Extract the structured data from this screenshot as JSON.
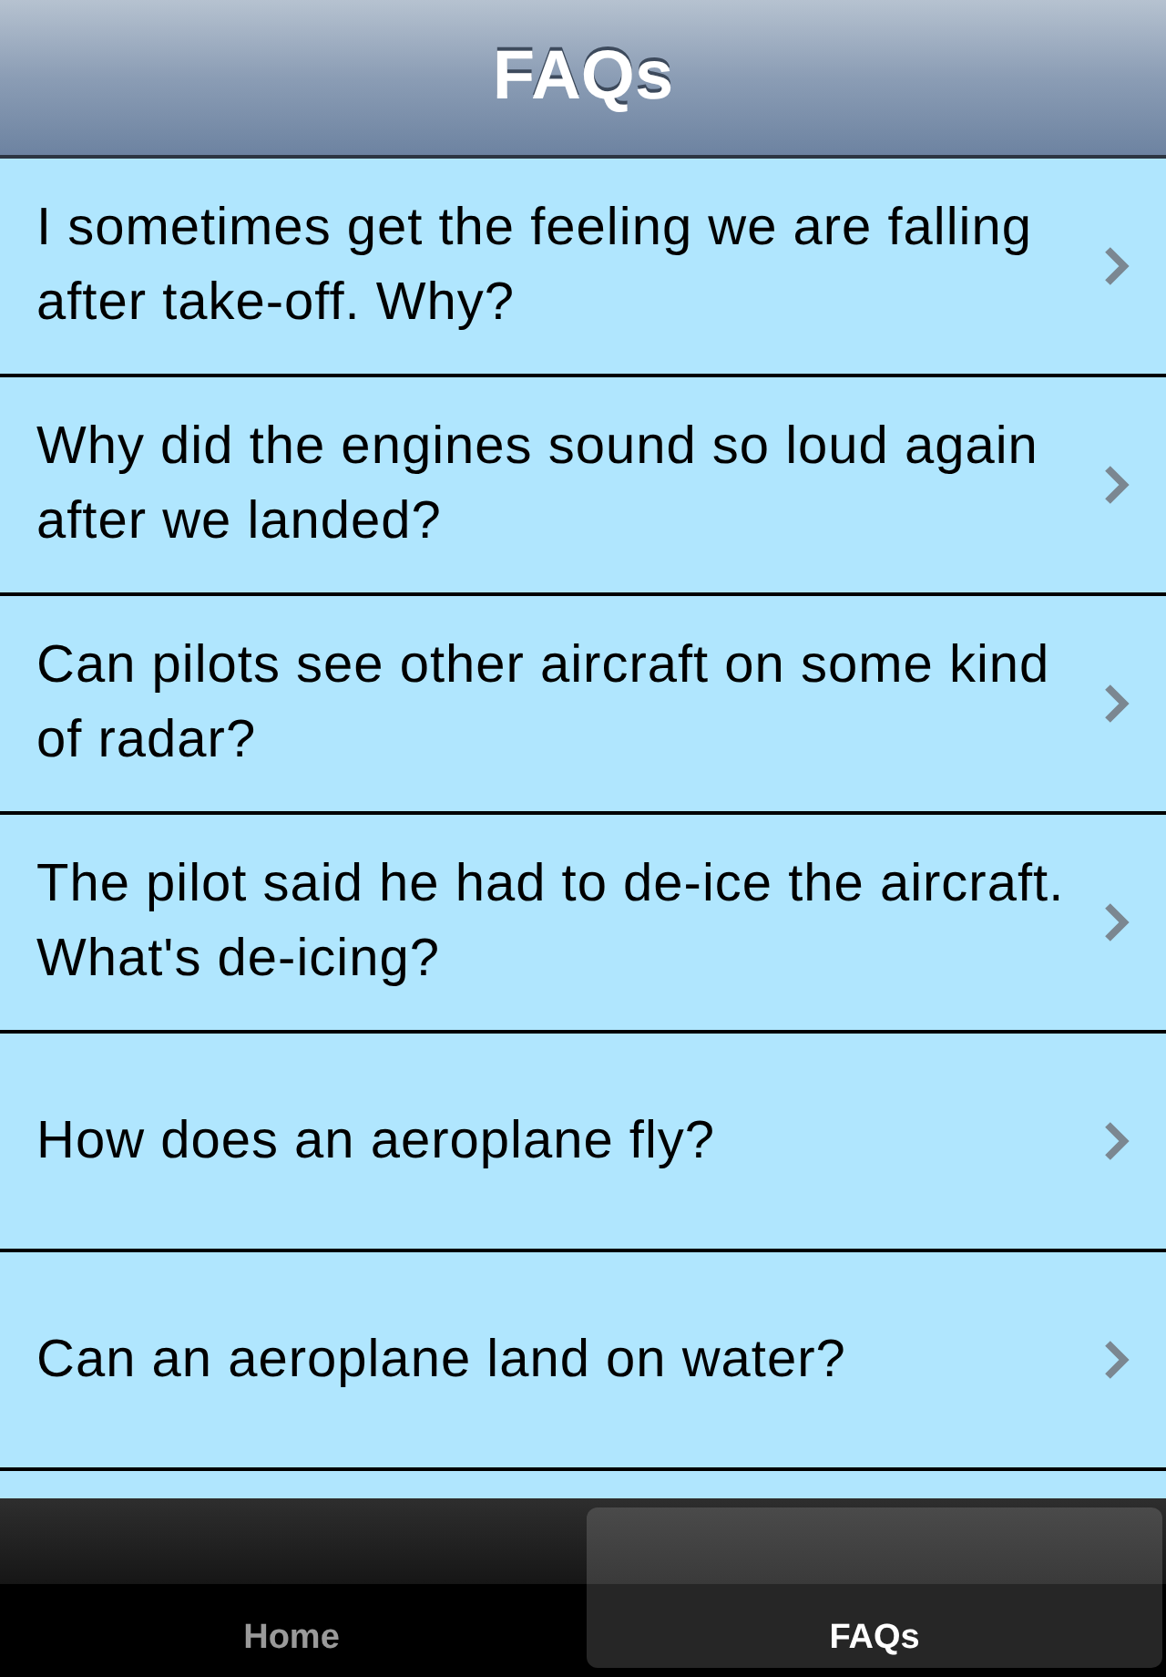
{
  "nav_bar": {
    "title": "FAQs"
  },
  "faqs": [
    {
      "question": "I sometimes get the feeling we are falling after take-off. Why?"
    },
    {
      "question": "Why did the engines sound so loud again after we landed?"
    },
    {
      "question": "Can pilots see other aircraft on some kind of radar?"
    },
    {
      "question": "The pilot said he had to de-ice the aircraft. What's de-icing?"
    },
    {
      "question": "How does an aeroplane fly?"
    },
    {
      "question": "Can an aeroplane land on water?"
    }
  ],
  "tab_bar": [
    {
      "label": "Home",
      "selected": false
    },
    {
      "label": "FAQs",
      "selected": true
    }
  ]
}
